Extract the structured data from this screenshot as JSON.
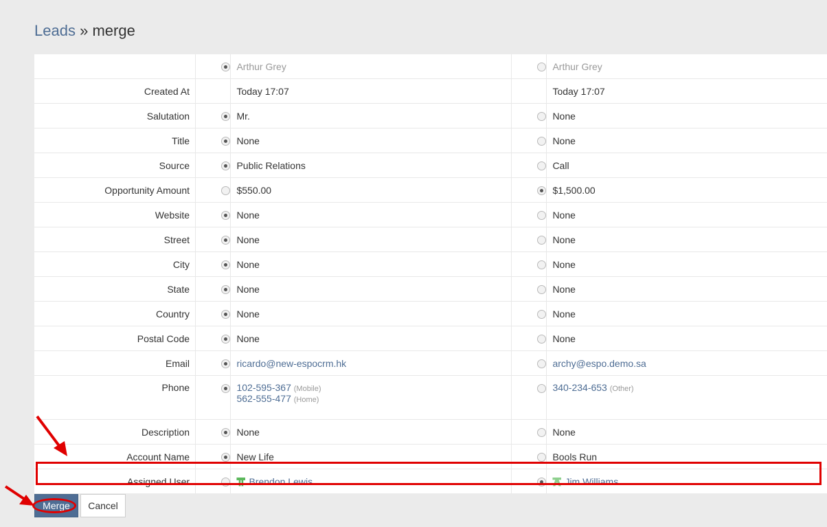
{
  "breadcrumb": {
    "parent": "Leads",
    "separator": "»",
    "current": "merge"
  },
  "rows": [
    {
      "label": "",
      "left": {
        "selected": true,
        "text": "Arthur Grey",
        "style": "muted"
      },
      "right": {
        "selected": false,
        "text": "Arthur Grey",
        "style": "muted"
      }
    },
    {
      "label": "Created At",
      "noRadio": true,
      "left": {
        "text": "Today 17:07"
      },
      "right": {
        "text": "Today 17:07"
      }
    },
    {
      "label": "Salutation",
      "left": {
        "selected": true,
        "text": "Mr."
      },
      "right": {
        "selected": false,
        "text": "None"
      }
    },
    {
      "label": "Title",
      "left": {
        "selected": true,
        "text": "None"
      },
      "right": {
        "selected": false,
        "text": "None"
      }
    },
    {
      "label": "Source",
      "left": {
        "selected": true,
        "text": "Public Relations"
      },
      "right": {
        "selected": false,
        "text": "Call"
      }
    },
    {
      "label": "Opportunity Amount",
      "left": {
        "selected": false,
        "text": "$550.00"
      },
      "right": {
        "selected": true,
        "text": "$1,500.00"
      }
    },
    {
      "label": "Website",
      "left": {
        "selected": true,
        "text": "None"
      },
      "right": {
        "selected": false,
        "text": "None"
      }
    },
    {
      "label": "Street",
      "left": {
        "selected": true,
        "text": "None"
      },
      "right": {
        "selected": false,
        "text": "None"
      }
    },
    {
      "label": "City",
      "left": {
        "selected": true,
        "text": "None"
      },
      "right": {
        "selected": false,
        "text": "None"
      }
    },
    {
      "label": "State",
      "left": {
        "selected": true,
        "text": "None"
      },
      "right": {
        "selected": false,
        "text": "None"
      }
    },
    {
      "label": "Country",
      "left": {
        "selected": true,
        "text": "None"
      },
      "right": {
        "selected": false,
        "text": "None"
      }
    },
    {
      "label": "Postal Code",
      "left": {
        "selected": true,
        "text": "None"
      },
      "right": {
        "selected": false,
        "text": "None"
      }
    },
    {
      "label": "Email",
      "left": {
        "selected": true,
        "text": "ricardo@new-espocrm.hk",
        "style": "link"
      },
      "right": {
        "selected": false,
        "text": "archy@espo.demo.sa",
        "style": "link"
      }
    },
    {
      "label": "Phone",
      "tall": true,
      "left": {
        "selected": true,
        "phones": [
          {
            "number": "102-595-367",
            "type": "(Mobile)"
          },
          {
            "number": "562-555-477",
            "type": "(Home)"
          }
        ]
      },
      "right": {
        "selected": false,
        "phones": [
          {
            "number": "340-234-653",
            "type": "(Other)"
          }
        ]
      }
    },
    {
      "label": "Description",
      "left": {
        "selected": true,
        "text": "None"
      },
      "right": {
        "selected": false,
        "text": "None"
      }
    },
    {
      "label": "Account Name",
      "left": {
        "selected": true,
        "text": "New Life"
      },
      "right": {
        "selected": false,
        "text": "Bools Run"
      }
    },
    {
      "label": "Assigned User",
      "left": {
        "selected": false,
        "text": "Brendon Lewis",
        "style": "link",
        "icon": "user-icon"
      },
      "right": {
        "selected": true,
        "text": "Jim Williams",
        "style": "link",
        "icon": "user-icon"
      }
    }
  ],
  "buttons": {
    "merge": "Merge",
    "cancel": "Cancel"
  },
  "colors": {
    "accent": "#4e6d94",
    "annotation": "#e00000",
    "userIcon": "#5cb85c"
  }
}
